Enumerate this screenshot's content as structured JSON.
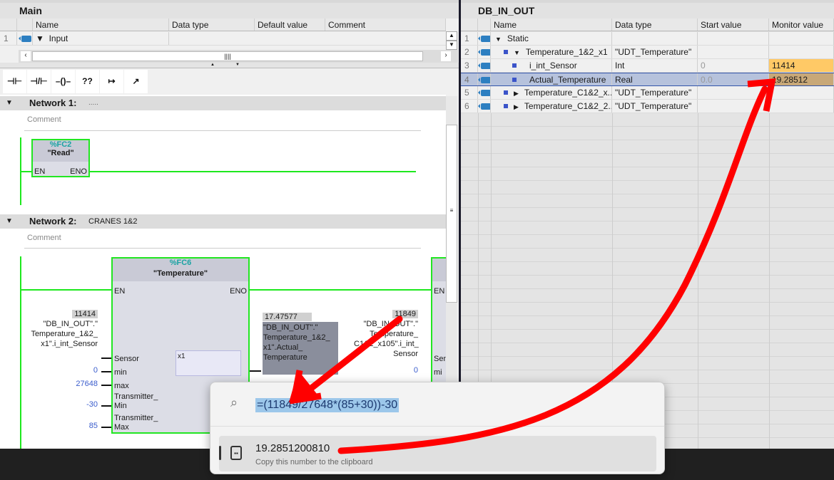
{
  "left_panel": {
    "title": "Main",
    "columns": [
      "Name",
      "Data type",
      "Default value",
      "Comment"
    ],
    "rows": [
      {
        "num": "1",
        "name": "Input"
      }
    ],
    "toolbar": [
      "⊣⊢",
      "⊣/⊢",
      "–()–",
      "??",
      "↦",
      "↗"
    ],
    "network1": {
      "title": "Network 1:",
      "subtitle": ".....",
      "comment": "Comment",
      "block_addr": "%FC2",
      "block_name": "\"Read\"",
      "en": "EN",
      "eno": "ENO"
    },
    "network2": {
      "title": "Network 2:",
      "subtitle": "CRANES 1&2",
      "comment": "Comment",
      "block_addr": "%FC6",
      "block_name": "\"Temperature\"",
      "en": "EN",
      "eno": "ENO",
      "inputs": [
        {
          "pin": "Sensor",
          "val": ""
        },
        {
          "pin": "min",
          "val": "0"
        },
        {
          "pin": "max",
          "val": "27648"
        },
        {
          "pin": "Transmitter_ Min",
          "val": "-30"
        },
        {
          "pin": "Transmitter_ Max",
          "val": "85"
        }
      ],
      "sensor_monitor": "11414",
      "sensor_tag": "\"DB_IN_OUT\".\" Temperature_1&2_ x1\".i_int_Sensor",
      "out_monitor": "17.47577",
      "out_tag": "\"DB_IN_OUT\".\" Temperature_1&2_ x1\".Actual_ Temperature",
      "tooltip": "x1",
      "sensor2_monitor": "11849",
      "sensor2_tag": "\"DB_IN_OUT\".\" Temperature_ C1&2_x105\".i_int_ Sensor",
      "min2": "0",
      "en2": "EN",
      "pin2a": "Sen",
      "pin2b": "mi"
    }
  },
  "right_panel": {
    "title": "DB_IN_OUT",
    "columns": [
      "Name",
      "Data type",
      "Start value",
      "Monitor value"
    ],
    "rows": [
      {
        "num": "1",
        "name": "Static",
        "type": "",
        "start": "",
        "monitor": ""
      },
      {
        "num": "2",
        "name": "Temperature_1&2_x1",
        "type": "\"UDT_Temperature\"",
        "start": "",
        "monitor": ""
      },
      {
        "num": "3",
        "name": "i_int_Sensor",
        "type": "Int",
        "start": "0",
        "monitor": "11414"
      },
      {
        "num": "4",
        "name": "Actual_Temperature",
        "type": "Real",
        "start": "0.0",
        "monitor": "19.28512"
      },
      {
        "num": "5",
        "name": "Temperature_C1&2_x...",
        "type": "\"UDT_Temperature\"",
        "start": "",
        "monitor": ""
      },
      {
        "num": "6",
        "name": "Temperature_C1&2_2...",
        "type": "\"UDT_Temperature\"",
        "start": "",
        "monitor": ""
      }
    ]
  },
  "search_popup": {
    "query": "=(11849/27648*(85+30))-30",
    "result": "19.2851200810",
    "result_hint": "Copy this number to the clipboard"
  },
  "colors": {
    "accent_green": "#22e622",
    "monitor_orange": "#ffc966",
    "monitor_brown": "#c8a878",
    "arrow": "#ff0000"
  }
}
